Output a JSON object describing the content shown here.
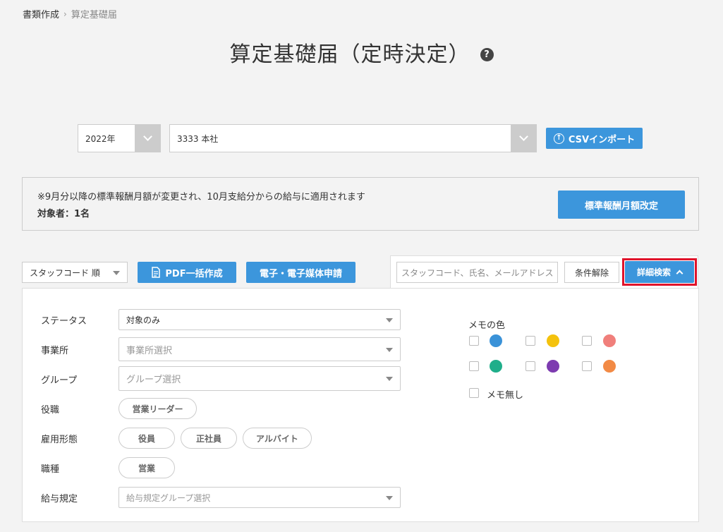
{
  "breadcrumb": {
    "parent": "書類作成",
    "current": "算定基礎届"
  },
  "title": "算定基礎届（定時決定）",
  "help_icon": "?",
  "year_select": {
    "value": "2022年"
  },
  "office_select": {
    "value": "3333 本社"
  },
  "csv_import": {
    "label": "CSVインポート",
    "icon": "↑"
  },
  "notice": {
    "line1": "※9月分以降の標準報酬月額が変更され、10月支給分からの給与に適用されます",
    "line2": "対象者：1名",
    "button": "標準報酬月額改定"
  },
  "toolbar": {
    "sort": "スタッフコード 順",
    "pdf": "PDF一括作成",
    "electronic": "電子・電子媒体申請",
    "search_placeholder": "スタッフコード、氏名、メールアドレス",
    "clear": "条件解除",
    "detail": "詳細検索"
  },
  "filters": {
    "status_label": "ステータス",
    "status_value": "対象のみ",
    "office_label": "事業所",
    "office_placeholder": "事業所選択",
    "group_label": "グループ",
    "group_placeholder": "グループ選択",
    "position_label": "役職",
    "position_chips": [
      "営業リーダー"
    ],
    "employment_label": "雇用形態",
    "employment_chips": [
      "役員",
      "正社員",
      "アルバイト"
    ],
    "job_label": "職種",
    "job_chips": [
      "営業"
    ],
    "salary_label": "給与規定",
    "salary_placeholder": "給与規定グループ選択"
  },
  "memo": {
    "title": "メモの色",
    "colors": [
      "#3a92d8",
      "#f4c20d",
      "#f07f7b",
      "#1fae8a",
      "#7d3bb0",
      "#f28a45"
    ],
    "none_label": "メモ無し"
  }
}
